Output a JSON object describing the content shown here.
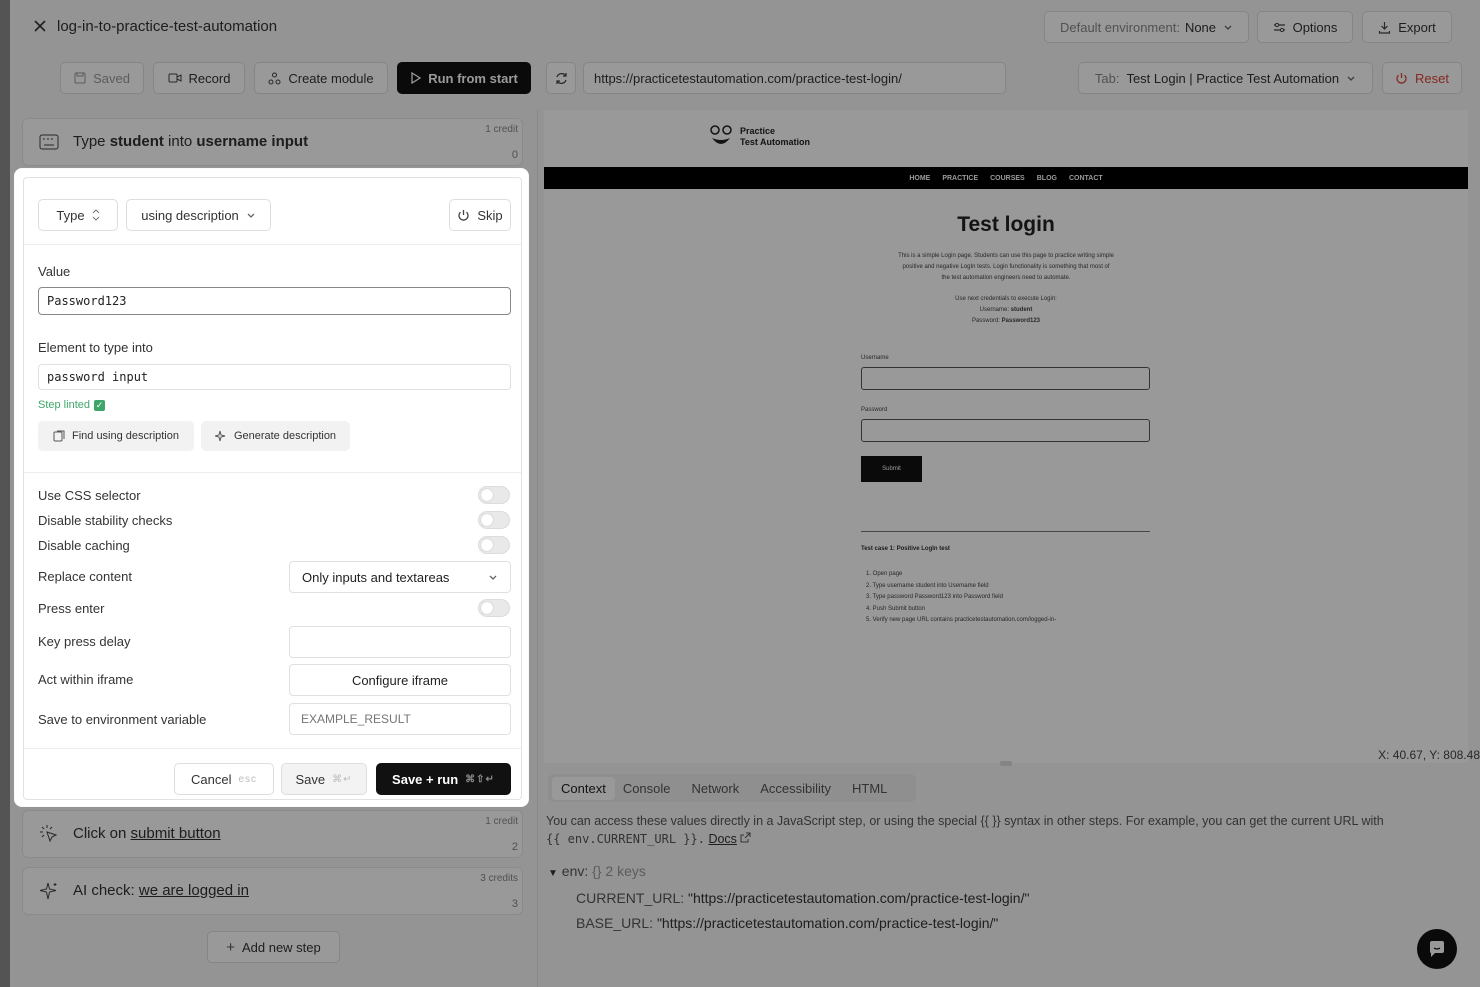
{
  "header": {
    "title": "log-in-to-practice-test-automation",
    "env_label": "Default environment:",
    "env_value": "None",
    "options_label": "Options",
    "export_label": "Export"
  },
  "toolbar": {
    "saved_label": "Saved",
    "record_label": "Record",
    "create_module_label": "Create module",
    "run_label": "Run from start",
    "url": "https://practicetestautomation.com/practice-test-login/",
    "tab_prefix": "Tab:",
    "tab_value": "Test Login | Practice Test Automation",
    "reset_label": "Reset"
  },
  "steps": {
    "step1": {
      "title_pre": "Type ",
      "title_bold1": "student",
      "title_mid": " into ",
      "title_bold2": "username input",
      "credit": "1 credit",
      "num": "0"
    },
    "step2": {
      "title_pre": "Click on ",
      "title_link": "submit button",
      "credit": "1 credit",
      "num": "2"
    },
    "step3": {
      "title_pre": "AI check: ",
      "title_link": "we are logged in",
      "credit": "3 credits",
      "num": "3"
    },
    "add_label": "Add new step"
  },
  "editor": {
    "action": "Type",
    "mode": "using description",
    "skip_label": "Skip",
    "value_label": "Value",
    "value": "Password123",
    "element_label": "Element to type into",
    "element_value": "password input",
    "linted": "Step linted",
    "find_label": "Find using description",
    "generate_label": "Generate description",
    "options": {
      "use_css": "Use CSS selector",
      "disable_stability": "Disable stability checks",
      "disable_caching": "Disable caching",
      "replace_content": "Replace content",
      "replace_value": "Only inputs and textareas",
      "press_enter": "Press enter",
      "key_delay": "Key press delay",
      "iframe": "Act within iframe",
      "iframe_button": "Configure iframe",
      "save_env": "Save to environment variable",
      "save_env_placeholder": "EXAMPLE_RESULT"
    },
    "cancel_label": "Cancel",
    "cancel_key": "esc",
    "save_label": "Save",
    "save_key": "⌘↵",
    "saverun_label": "Save + run",
    "saverun_key": "⌘⇧↵"
  },
  "preview": {
    "logo_line1": "Practice",
    "logo_line2": "Test Automation",
    "nav": [
      "HOME",
      "PRACTICE",
      "COURSES",
      "BLOG",
      "CONTACT"
    ],
    "heading": "Test login",
    "intro1": "This is a simple Login page. Students can use this page to practice writing simple",
    "intro2": "positive and negative LogIn tests. Login functionality is something that most of",
    "intro3": "the test automation engineers need to automate.",
    "creds_intro": "Use next credentials to execute Login:",
    "creds_user_label": "Username:",
    "creds_user": "student",
    "creds_pass_label": "Password:",
    "creds_pass": "Password123",
    "username_label": "Username",
    "password_label": "Password",
    "submit_label": "Submit",
    "case_title": "Test case 1: Positive LogIn test",
    "case_steps": [
      "1. Open page",
      "2. Type username student into Username field",
      "3. Type password Password123 into Password field",
      "4. Push Submit button",
      "5. Verify new page URL contains practicetestautomation.com/logged-in-"
    ]
  },
  "coords": "X: 40.67, Y: 808.48",
  "bottom": {
    "tabs": [
      "Context",
      "Console",
      "Network",
      "Accessibility",
      "HTML"
    ],
    "info1": "You can access these values directly in a JavaScript step, or using the special {{ }} syntax in other steps. For example, you can get the current URL with",
    "info2_code": "{{ env.CURRENT_URL }}.",
    "docs": "Docs",
    "env_label": "env:",
    "env_type": "{}",
    "env_count": "2 keys",
    "current_url_key": "CURRENT_URL:",
    "current_url_val": "\"https://practicetestautomation.com/practice-test-login/\"",
    "base_url_key": "BASE_URL:",
    "base_url_val": "\"https://practicetestautomation.com/practice-test-login/\""
  }
}
